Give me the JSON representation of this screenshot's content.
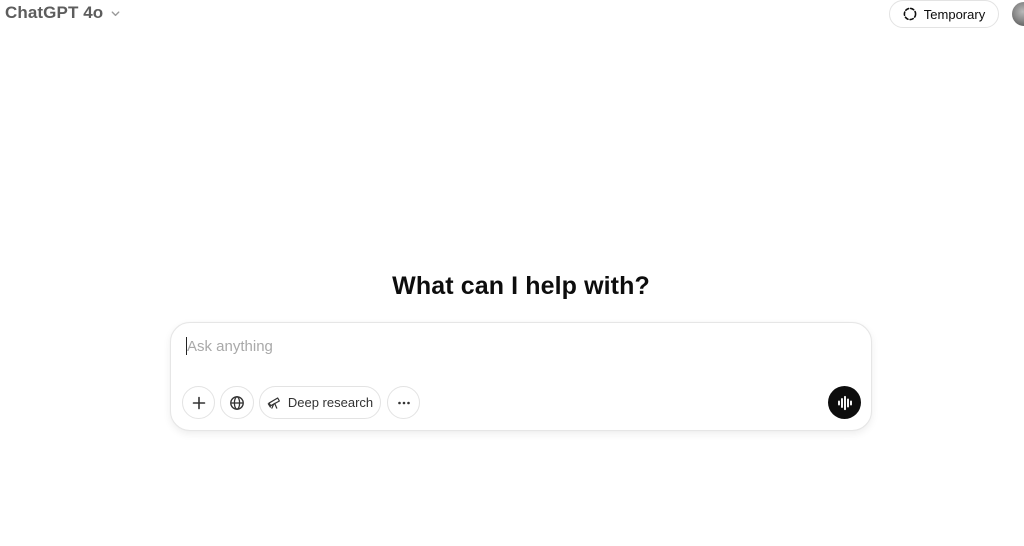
{
  "header": {
    "model_name": "ChatGPT 4o",
    "model_chevron_icon": "chevron-down-icon",
    "temporary_label": "Temporary",
    "temporary_icon": "dashed-circle-icon"
  },
  "main": {
    "heading": "What can I help with?",
    "composer": {
      "placeholder": "Ask anything",
      "value": "",
      "tools": {
        "attach_icon": "plus-icon",
        "search_icon": "globe-icon",
        "deep_research_label": "Deep research",
        "deep_research_icon": "telescope-icon",
        "more_icon": "ellipsis-icon"
      },
      "voice_icon": "voice-waveform-icon"
    }
  },
  "colors": {
    "text_primary": "#0d0d0d",
    "text_muted": "#5d5d5d",
    "placeholder": "#a9a9a9",
    "border": "#e3e3e3",
    "voice_button": "#0d0d0d"
  }
}
